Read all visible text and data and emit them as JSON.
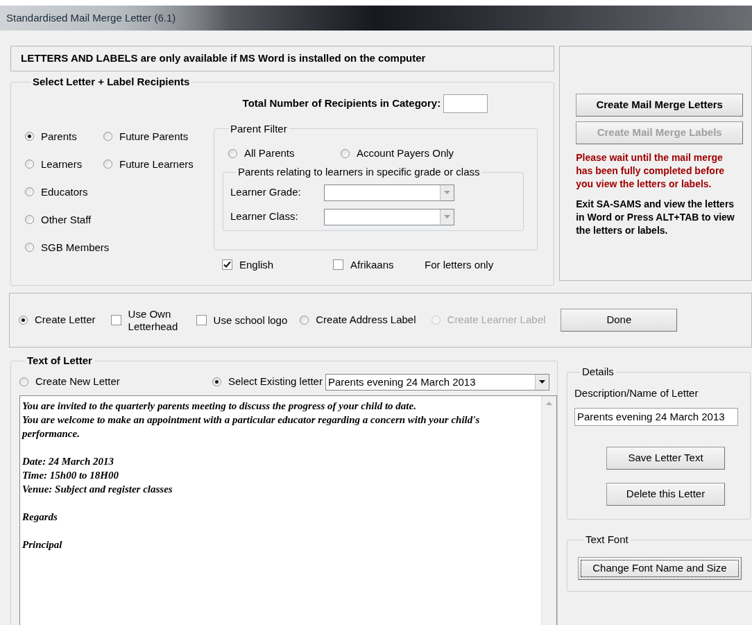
{
  "window": {
    "title": "Standardised Mail Merge Letter (6.1)"
  },
  "notice": "LETTERS AND LABELS are only available if MS Word is installed on the computer",
  "recipients": {
    "title": "Select Letter + Label Recipients",
    "total_label": "Total Number of Recipients in Category:",
    "option_rows": [
      [
        {
          "label": "Parents",
          "selected": true
        },
        {
          "label": "Future Parents",
          "selected": false
        }
      ],
      [
        {
          "label": "Learners",
          "selected": false
        },
        {
          "label": "Future Learners",
          "selected": false
        }
      ],
      [
        {
          "label": "Educators",
          "selected": false
        }
      ],
      [
        {
          "label": "Other Staff",
          "selected": false
        }
      ],
      [
        {
          "label": "SGB Members",
          "selected": false
        }
      ]
    ],
    "parent_filter": {
      "title": "Parent Filter",
      "options": [
        {
          "label": "All Parents",
          "selected": false
        },
        {
          "label": "Account Payers Only",
          "selected": false
        }
      ],
      "specific": {
        "title": "Parents relating to learners in specific grade or class",
        "fields": [
          {
            "label": "Learner Grade:"
          },
          {
            "label": "Learner Class:"
          }
        ]
      }
    },
    "languages": [
      {
        "label": "English",
        "checked": true
      },
      {
        "label": "Afrikaans",
        "checked": false
      }
    ],
    "language_note": "For letters only"
  },
  "actions": {
    "buttons": [
      {
        "label": "Create Mail Merge Letters",
        "disabled": false
      },
      {
        "label": "Create Mail Merge Labels",
        "disabled": true
      }
    ],
    "warning": "Please wait until the mail merge has been fully completed before you view the letters or labels.",
    "info": "Exit SA-SAMS and view the letters in Word or Press ALT+TAB to view the letters or labels."
  },
  "output": {
    "items": [
      {
        "kind": "radio",
        "label": "Create Letter",
        "selected": true,
        "disabled": false
      },
      {
        "kind": "checkbox",
        "label": "Use Own Letterhead",
        "checked": false
      },
      {
        "kind": "checkbox",
        "label": "Use school logo",
        "checked": false
      },
      {
        "kind": "radio",
        "label": "Create Address Label",
        "selected": false,
        "disabled": false
      },
      {
        "kind": "radio",
        "label": "Create Learner Label",
        "selected": false,
        "disabled": true
      }
    ],
    "done_button": "Done"
  },
  "letter": {
    "title": "Text of Letter",
    "modes": [
      {
        "label": "Create New Letter",
        "selected": false
      },
      {
        "label": "Select Existing letter",
        "selected": true
      }
    ],
    "existing_value": "Parents evening 24 March 2013",
    "paragraphs": [
      {
        "lines": [
          "You are invited to the quarterly parents meeting to discuss the progress of your child to date.",
          "You are welcome to make an appointment with a particular educator regarding a  concern with your child's performance."
        ]
      },
      {
        "lines": [
          "Date: 24 March 2013",
          "Time: 15h00 to 18H00",
          "Venue: Subject and register classes"
        ]
      },
      {
        "lines": [
          "Regards"
        ]
      },
      {
        "lines": [
          "Principal"
        ]
      }
    ],
    "details": {
      "title": "Details",
      "name_label": "Description/Name of Letter",
      "name_value": "Parents evening 24 March 2013",
      "buttons": [
        "Save Letter Text",
        "Delete this Letter"
      ]
    },
    "font": {
      "title": "Text Font",
      "button": "Change Font Name and Size"
    }
  }
}
